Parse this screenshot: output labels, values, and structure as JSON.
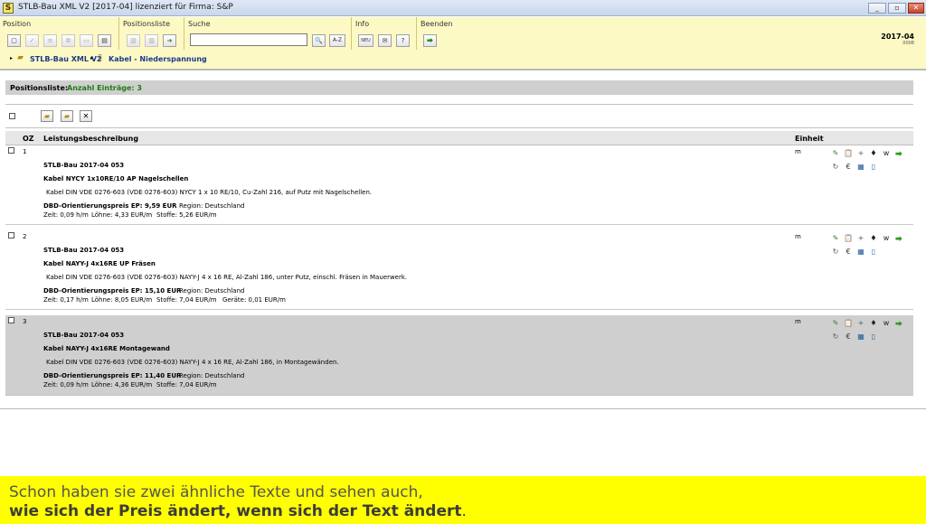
{
  "window": {
    "title": "STLB-Bau XML V2 [2017-04] lizenziert für Firma: S&P",
    "app_icon_letter": "S",
    "btn_min": "_",
    "btn_max": "▫",
    "btn_close": "✕"
  },
  "toolbar": {
    "groups": {
      "position": "Position",
      "positionsliste": "Positionsliste",
      "suche": "Suche",
      "info": "Info",
      "beenden": "Beenden"
    },
    "search": {
      "value": "",
      "placeholder": ""
    },
    "search_btn": "🔍",
    "az_btn": "A-Z",
    "neu_btn": "NEU",
    "mail_btn": "✉",
    "help_btn": "?",
    "exit_btn": "⮕",
    "version": "2017-04",
    "version_sub": "0008"
  },
  "breadcrumb": {
    "root": "STLB-Bau XML V2",
    "current": "Kabel - Niederspannung"
  },
  "list": {
    "label": "Positionsliste:",
    "count": "Anzahl Einträge: 3"
  },
  "columns": {
    "oz": "OZ",
    "desc": "Leistungsbeschreibung",
    "unit": "Einheit"
  },
  "row_icons": [
    "✎",
    "📋",
    "+",
    "♦",
    "w",
    "⮕",
    "↻",
    "€",
    "▦",
    "▯"
  ],
  "items": [
    {
      "oz": "1",
      "unit": "m",
      "code": "STLB-Bau 2017-04 053",
      "title": "Kabel NYCY 1x10RE/10 AP Nagelschellen",
      "text": "Kabel DIN VDE 0276-603 (VDE 0276-603) NYCY 1 x 10 RE/10, Cu-Zahl 216, auf Putz mit Nagelschellen.",
      "price": "DBD-Orientierungspreis EP: 9,59 EUR",
      "region": "Region: Deutschland",
      "zeit": "Zeit: 0,09 h/m",
      "loehne": "Löhne: 4,33 EUR/m",
      "stoffe": "Stoffe: 5,26 EUR/m",
      "geraete": ""
    },
    {
      "oz": "2",
      "unit": "m",
      "code": "STLB-Bau 2017-04 053",
      "title": "Kabel NAYY-J 4x16RE UP Fräsen",
      "text": "Kabel DIN VDE 0276-603 (VDE 0276-603) NAYY-J 4 x 16 RE, Al-Zahl 186, unter Putz, einschl. Fräsen in Mauerwerk.",
      "price": "DBD-Orientierungspreis EP: 15,10 EUR",
      "region": "Region: Deutschland",
      "zeit": "Zeit: 0,17 h/m",
      "loehne": "Löhne: 8,05 EUR/m",
      "stoffe": "Stoffe: 7,04 EUR/m",
      "geraete": "Geräte: 0,01 EUR/m"
    },
    {
      "oz": "3",
      "unit": "m",
      "code": "STLB-Bau 2017-04 053",
      "title": "Kabel NAYY-J 4x16RE Montagewand",
      "text": "Kabel DIN VDE 0276-603 (VDE 0276-603) NAYY-J 4 x 16 RE, Al-Zahl 186, in Montagewänden.",
      "price": "DBD-Orientierungspreis EP: 11,40 EUR",
      "region": "Region: Deutschland",
      "zeit": "Zeit: 0,09 h/m",
      "loehne": "Löhne: 4,36 EUR/m",
      "stoffe": "Stoffe: 7,04 EUR/m",
      "geraete": ""
    }
  ],
  "caption": {
    "line1": "Schon haben sie zwei  ähnliche Texte und sehen auch,",
    "line2": "wie sich der Preis ändert, wenn sich der Text ändert",
    "line2_end": "."
  },
  "colors": {
    "toolbar_bg": "#fdf9c4",
    "selected_row": "#cfcfcf",
    "count_green": "#1f7a12",
    "caption_bg": "#ffff00"
  }
}
